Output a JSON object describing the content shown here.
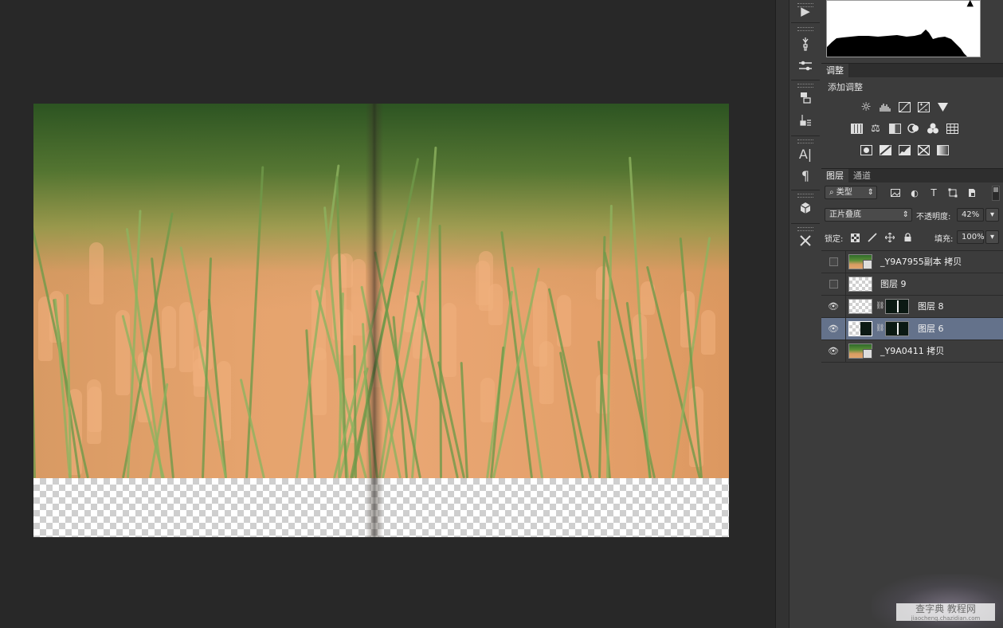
{
  "adjustments": {
    "tab_label": "调整",
    "add_adjustment_label": "添加调整"
  },
  "layers_panel": {
    "tabs": [
      "图层",
      "通道"
    ],
    "filter_kind": "类型",
    "blend_mode": "正片叠底",
    "opacity_label": "不透明度:",
    "opacity_value": "42%",
    "lock_label": "锁定:",
    "fill_label": "填充:",
    "fill_value": "100%",
    "layers": [
      {
        "name": "_Y9A7955副本 拷贝",
        "visible": false,
        "thumb": "photo-smart-object",
        "mask": false,
        "selected": false
      },
      {
        "name": "图层 9",
        "visible": false,
        "thumb": "transparent",
        "mask": false,
        "selected": false
      },
      {
        "name": "图层 8",
        "visible": true,
        "thumb": "transparent",
        "mask": true,
        "selected": false
      },
      {
        "name": "图层 6",
        "visible": true,
        "thumb": "half-dark",
        "mask": true,
        "selected": true
      },
      {
        "name": "_Y9A0411 拷贝",
        "visible": true,
        "thumb": "photo-smart-object",
        "mask": false,
        "selected": false
      }
    ]
  },
  "watermark": {
    "text": "查字典 教程网",
    "sub": "jiaocheng.chazidian.com"
  },
  "colors": {
    "workspace_bg": "#282828",
    "panel_bg": "#3c3c3c",
    "selected_layer": "#64728b"
  }
}
